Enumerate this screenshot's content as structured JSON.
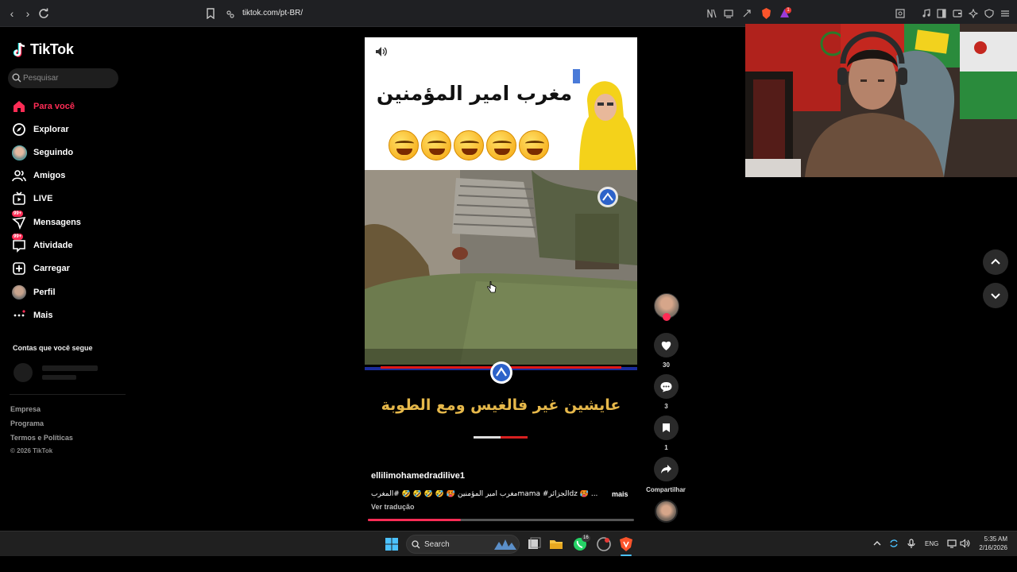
{
  "browser": {
    "url": "tiktok.com/pt-BR/",
    "tab_badge": "1"
  },
  "sidebar": {
    "app_name": "TikTok",
    "search_placeholder": "Pesquisar",
    "items": [
      {
        "label": "Para você",
        "icon": "home-icon",
        "active": true
      },
      {
        "label": "Explorar",
        "icon": "compass-icon"
      },
      {
        "label": "Seguindo",
        "icon": "following-avatar-icon"
      },
      {
        "label": "Amigos",
        "icon": "friends-icon"
      },
      {
        "label": "LIVE",
        "icon": "live-tv-icon"
      },
      {
        "label": "Mensagens",
        "icon": "messages-icon",
        "badge": "99+"
      },
      {
        "label": "Atividade",
        "icon": "activity-icon",
        "badge": "99+"
      },
      {
        "label": "Carregar",
        "icon": "upload-plus-icon"
      },
      {
        "label": "Perfil",
        "icon": "profile-avatar-icon"
      },
      {
        "label": "Mais",
        "icon": "more-dots-icon"
      }
    ],
    "following_title": "Contas que você segue",
    "footer": [
      "Empresa",
      "Programa",
      "Termos e Políticas"
    ],
    "copyright": "© 2026 TikTok"
  },
  "video": {
    "headline": "مغرب امير المؤمنين",
    "bottom_caption": "عايشين غير فالغيس ومع الطوبة",
    "username": "ellilimohamedradilive1",
    "description": "مغرب امير المؤمنين 🥵 🤣 🤣 🤣 🤣 #المغربmama #الجزائرdz 🥵 ...",
    "more_label": "mais",
    "translate_label": "Ver tradução",
    "progress": 0.35
  },
  "actions": {
    "likes": "30",
    "comments": "3",
    "saves": "1",
    "share_label": "Compartilhar"
  },
  "taskbar": {
    "search_label": "Search",
    "whatsapp_badge": "16",
    "lang": "ENG",
    "time": "5:35 AM",
    "date": "2/16/2026"
  },
  "colors": {
    "accent": "#fe2c55",
    "background": "#000000",
    "caption_gold": "#e6b84a"
  }
}
